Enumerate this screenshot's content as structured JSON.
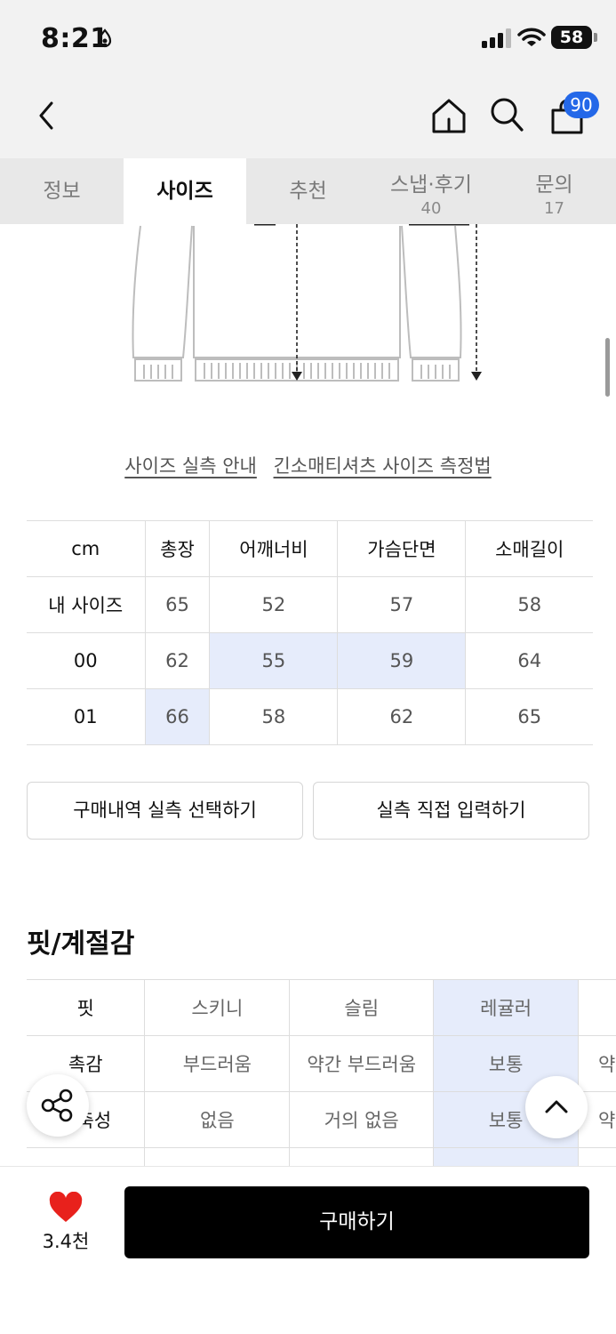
{
  "status_bar": {
    "time": "8:21",
    "battery": "58"
  },
  "header": {
    "cart_count": "90",
    "icons": [
      "chevron-left-icon",
      "home-icon",
      "search-icon",
      "shopping-bag-icon"
    ]
  },
  "tabs": [
    {
      "label": "정보",
      "count": ""
    },
    {
      "label": "사이즈",
      "count": "",
      "active": true
    },
    {
      "label": "추천",
      "count": ""
    },
    {
      "label": "스냅·후기",
      "count": "40"
    },
    {
      "label": "문의",
      "count": "17"
    }
  ],
  "guide_links": {
    "size_guide": "사이즈 실측 안내",
    "measure_guide": "긴소매티셔츠 사이즈 측정법"
  },
  "size_table": {
    "headers": [
      "cm",
      "총장",
      "어깨너비",
      "가슴단면",
      "소매길이"
    ],
    "rows": [
      {
        "label": "내 사이즈",
        "values": [
          "65",
          "52",
          "57",
          "58"
        ]
      },
      {
        "label": "00",
        "values": [
          "62",
          "55",
          "59",
          "64"
        ]
      },
      {
        "label": "01",
        "values": [
          "66",
          "58",
          "62",
          "65"
        ]
      }
    ]
  },
  "buttons": {
    "select_purchase": "구매내역 실측 선택하기",
    "manual_input": "실측 직접 입력하기",
    "buy": "구매하기"
  },
  "fit_section": {
    "title": "핏/계절감",
    "rows": [
      {
        "label": "핏",
        "options": [
          "스키니",
          "슬림",
          "레귤러",
          ""
        ],
        "selected": 2
      },
      {
        "label": "촉감",
        "options": [
          "부드러움",
          "약간 부드러움",
          "보통",
          "약"
        ],
        "selected": 2
      },
      {
        "label": "신축성",
        "options": [
          "없음",
          "거의 없음",
          "보통",
          "약"
        ],
        "selected": 2
      }
    ]
  },
  "like": {
    "count": "3.4천"
  },
  "colors": {
    "accent_blue": "#2468e8",
    "highlight": "#e6ecfb",
    "like_red": "#e8211c"
  }
}
